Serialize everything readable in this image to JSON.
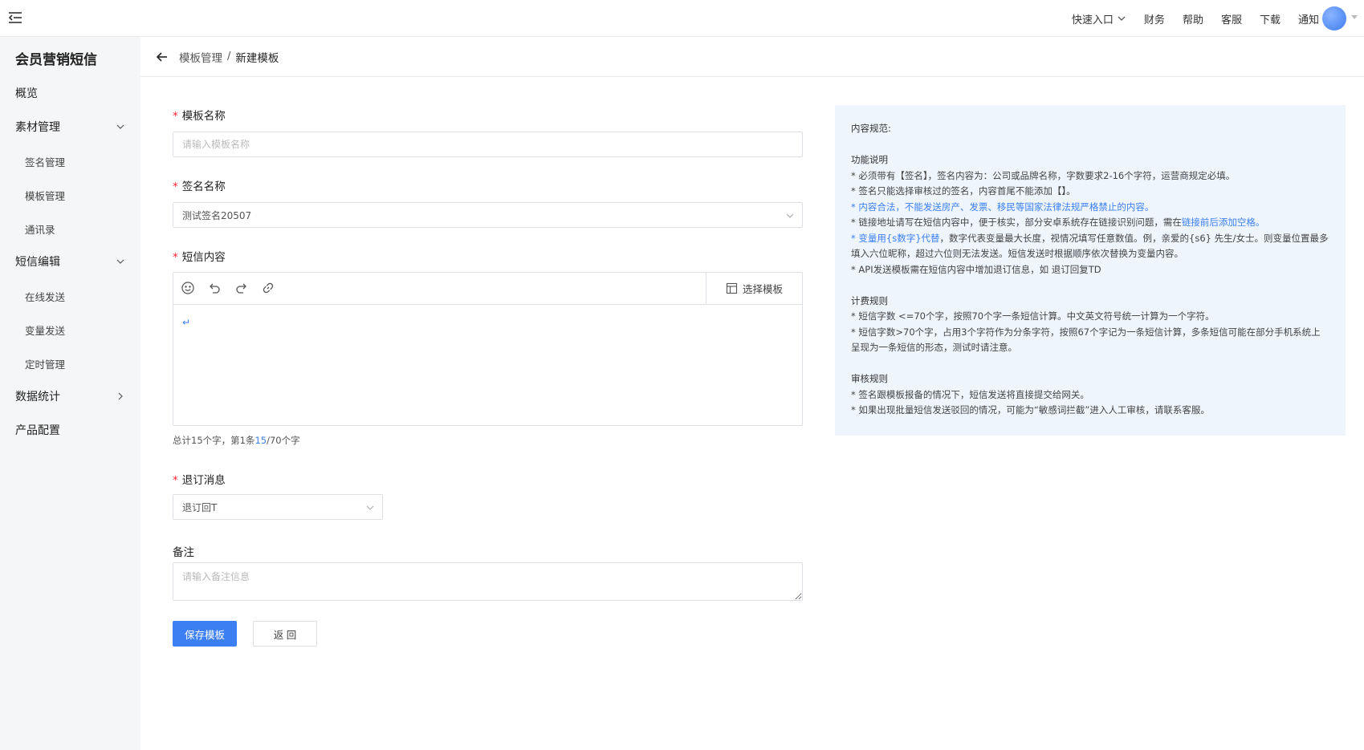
{
  "topbar": {
    "quick_entry": "快速入口",
    "finance": "财务",
    "help": "帮助",
    "service": "客服",
    "download": "下载",
    "notify": "通知"
  },
  "sidebar": {
    "title": "会员营销短信",
    "items": [
      {
        "label": "概览"
      },
      {
        "label": "素材管理"
      },
      {
        "label": "签名管理"
      },
      {
        "label": "模板管理"
      },
      {
        "label": "通讯录"
      },
      {
        "label": "短信编辑"
      },
      {
        "label": "在线发送"
      },
      {
        "label": "变量发送"
      },
      {
        "label": "定时管理"
      },
      {
        "label": "数据统计"
      },
      {
        "label": "产品配置"
      }
    ]
  },
  "breadcrumb": {
    "parent": "模板管理",
    "separator": "/",
    "current": "新建模板"
  },
  "form": {
    "template_name": {
      "label": "模板名称",
      "placeholder": "请输入模板名称",
      "required_mark": "*"
    },
    "signature": {
      "label": "签名名称",
      "value": "测试签名20507",
      "required_mark": "*"
    },
    "content": {
      "label": "短信内容",
      "required_mark": "*",
      "select_template": "选择模板",
      "body": "↵"
    },
    "counter": {
      "prefix": "总计15个字，第1条",
      "current": "15",
      "suffix": "/70个字"
    },
    "unsubscribe": {
      "label": "退订消息",
      "value": "退订回T",
      "required_mark": "*"
    },
    "remark": {
      "label": "备注",
      "placeholder": "请输入备注信息"
    },
    "save_button": "保存模板",
    "back_button": "返 回"
  },
  "rules": {
    "title": "内容规范:",
    "function_title": "功能说明",
    "f1": "* 必须带有【签名】，签名内容为：公司或品牌名称，字数要求2-16个字符，运营商规定必填。",
    "f2": "* 签名只能选择审核过的签名，内容首尾不能添加【】。",
    "f3": "* 内容合法，不能发送房产、发票、移民等国家法律法规严格禁止的内容。",
    "f4_a": "* 链接地址请写在短信内容中，便于核实，部分安卓系统存在链接识别问题，需在",
    "f4_b": "链接前后添加空格",
    "f4_c": "。",
    "f5_a": "* ",
    "f5_b": "变量用{s数字}代替",
    "f5_c": "，数字代表变量最大长度，视情况填写任意数值。例，亲爱的{s6} 先生/女士。则变量位置最多填入六位昵称，超过六位则无法发送。短信发送时根据顺序依次替换为变量内容。",
    "f6": "* API发送模板需在短信内容中增加退订信息，如 退订回复TD",
    "billing_title": "计费规则",
    "b1": "* 短信字数 <=70个字，按照70个字一条短信计算。中文英文符号统一计算为一个字符。",
    "b2": "* 短信字数>70个字，占用3个字符作为分条字符，按照67个字记为一条短信计算，多条短信可能在部分手机系统上呈现为一条短信的形态，测试时请注意。",
    "review_title": "审核规则",
    "r1": "* 签名跟模板报备的情况下，短信发送将直接提交给网关。",
    "r2": "* 如果出现批量短信发送驳回的情况，可能为“敏感词拦截”进入人工审核，请联系客服。"
  }
}
